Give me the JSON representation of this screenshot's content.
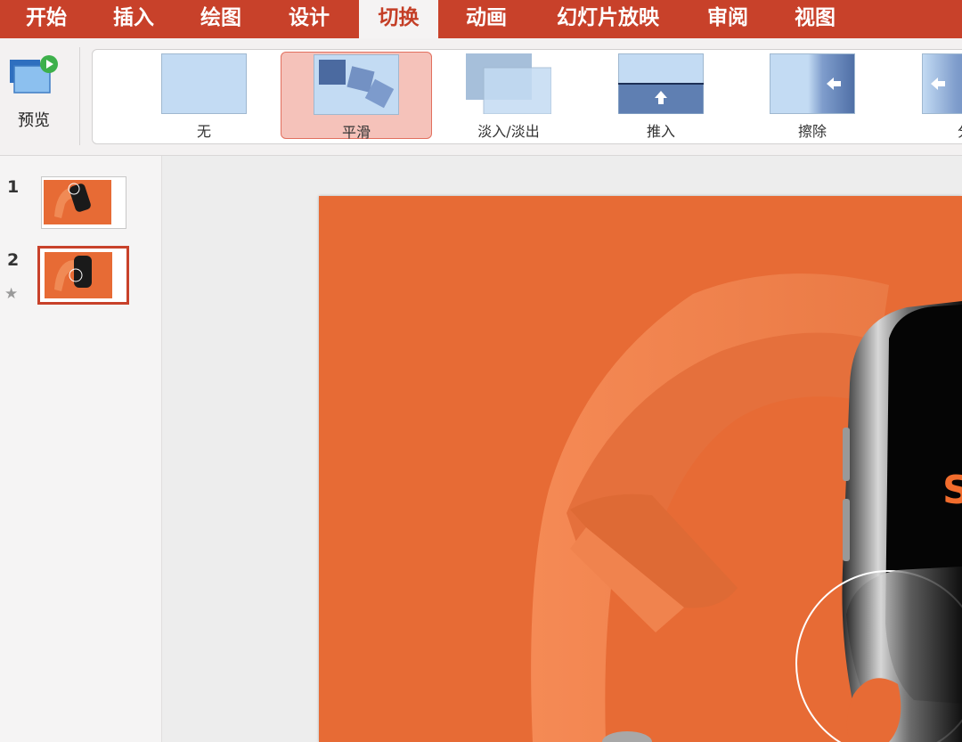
{
  "ribbon_tabs": [
    {
      "label": "开始"
    },
    {
      "label": "插入"
    },
    {
      "label": "绘图"
    },
    {
      "label": "设计"
    },
    {
      "label": "切换",
      "active": true
    },
    {
      "label": "动画"
    },
    {
      "label": "幻灯片放映"
    },
    {
      "label": "审阅"
    },
    {
      "label": "视图"
    }
  ],
  "preview": {
    "label": "预览",
    "icon": "preview-play-icon"
  },
  "transitions": [
    {
      "label": "无"
    },
    {
      "label": "平滑",
      "selected": true
    },
    {
      "label": "淡入/淡出"
    },
    {
      "label": "推入"
    },
    {
      "label": "擦除"
    },
    {
      "label": "分"
    }
  ],
  "slides": [
    {
      "number": "1"
    },
    {
      "number": "2",
      "selected": true,
      "has_animation": true,
      "animation_icon": "star-icon"
    }
  ],
  "colors": {
    "ribbon_accent": "#c8412a",
    "slide_background": "#e76b35",
    "selected_transition": "#f5c2ba"
  }
}
